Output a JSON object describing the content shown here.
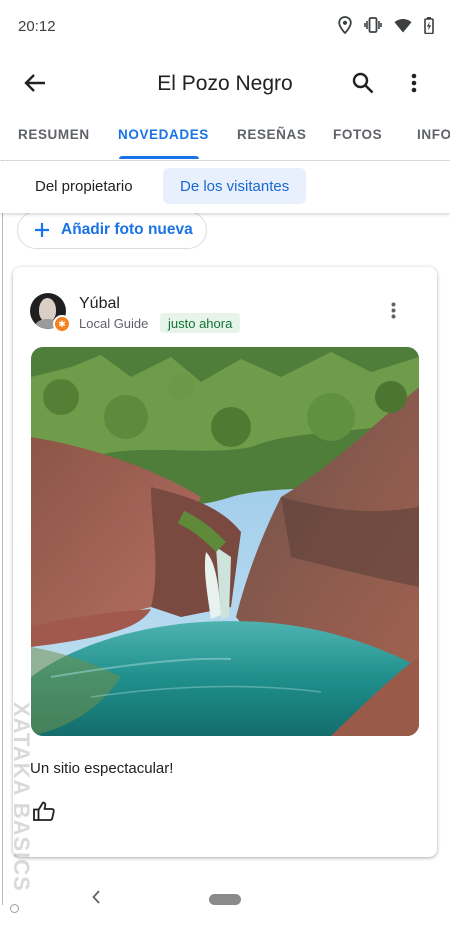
{
  "status_bar": {
    "time": "20:12",
    "icons": [
      "location-icon",
      "vibrate-icon",
      "wifi-icon",
      "battery-charging-icon"
    ]
  },
  "app_bar": {
    "title": "El Pozo Negro",
    "icons": [
      "back-arrow-icon",
      "search-icon",
      "more-vert-icon"
    ]
  },
  "tabs": [
    {
      "label": "RESUMEN",
      "active": false
    },
    {
      "label": "NOVEDADES",
      "active": true
    },
    {
      "label": "RESEÑAS",
      "active": false
    },
    {
      "label": "FOTOS",
      "active": false
    },
    {
      "label": "INFO",
      "active": false
    }
  ],
  "filters": {
    "owner_label": "Del propietario",
    "visitors_label": "De los visitantes",
    "selected": "De los visitantes"
  },
  "add_photo": {
    "label": "Añadir foto nueva",
    "icon": "plus-icon"
  },
  "post": {
    "author_name": "Yúbal",
    "author_level": "Local Guide",
    "time_badge": "justo ahora",
    "caption": "Un sitio espectacular!",
    "icons": [
      "avatar",
      "local-guide-badge-icon",
      "more-vert-icon",
      "thumbs-up-icon"
    ]
  },
  "watermark": {
    "text": "XATAKA BASICS"
  },
  "nav_bar": {
    "icons": [
      "nav-back-icon",
      "home-pill"
    ]
  },
  "colors": {
    "accent": "#1a73e8",
    "chip_selected_bg": "#e8f0fe",
    "badge_green_bg": "#e6f4ea",
    "badge_green_text": "#137333",
    "guide_orange": "#f5821f"
  }
}
